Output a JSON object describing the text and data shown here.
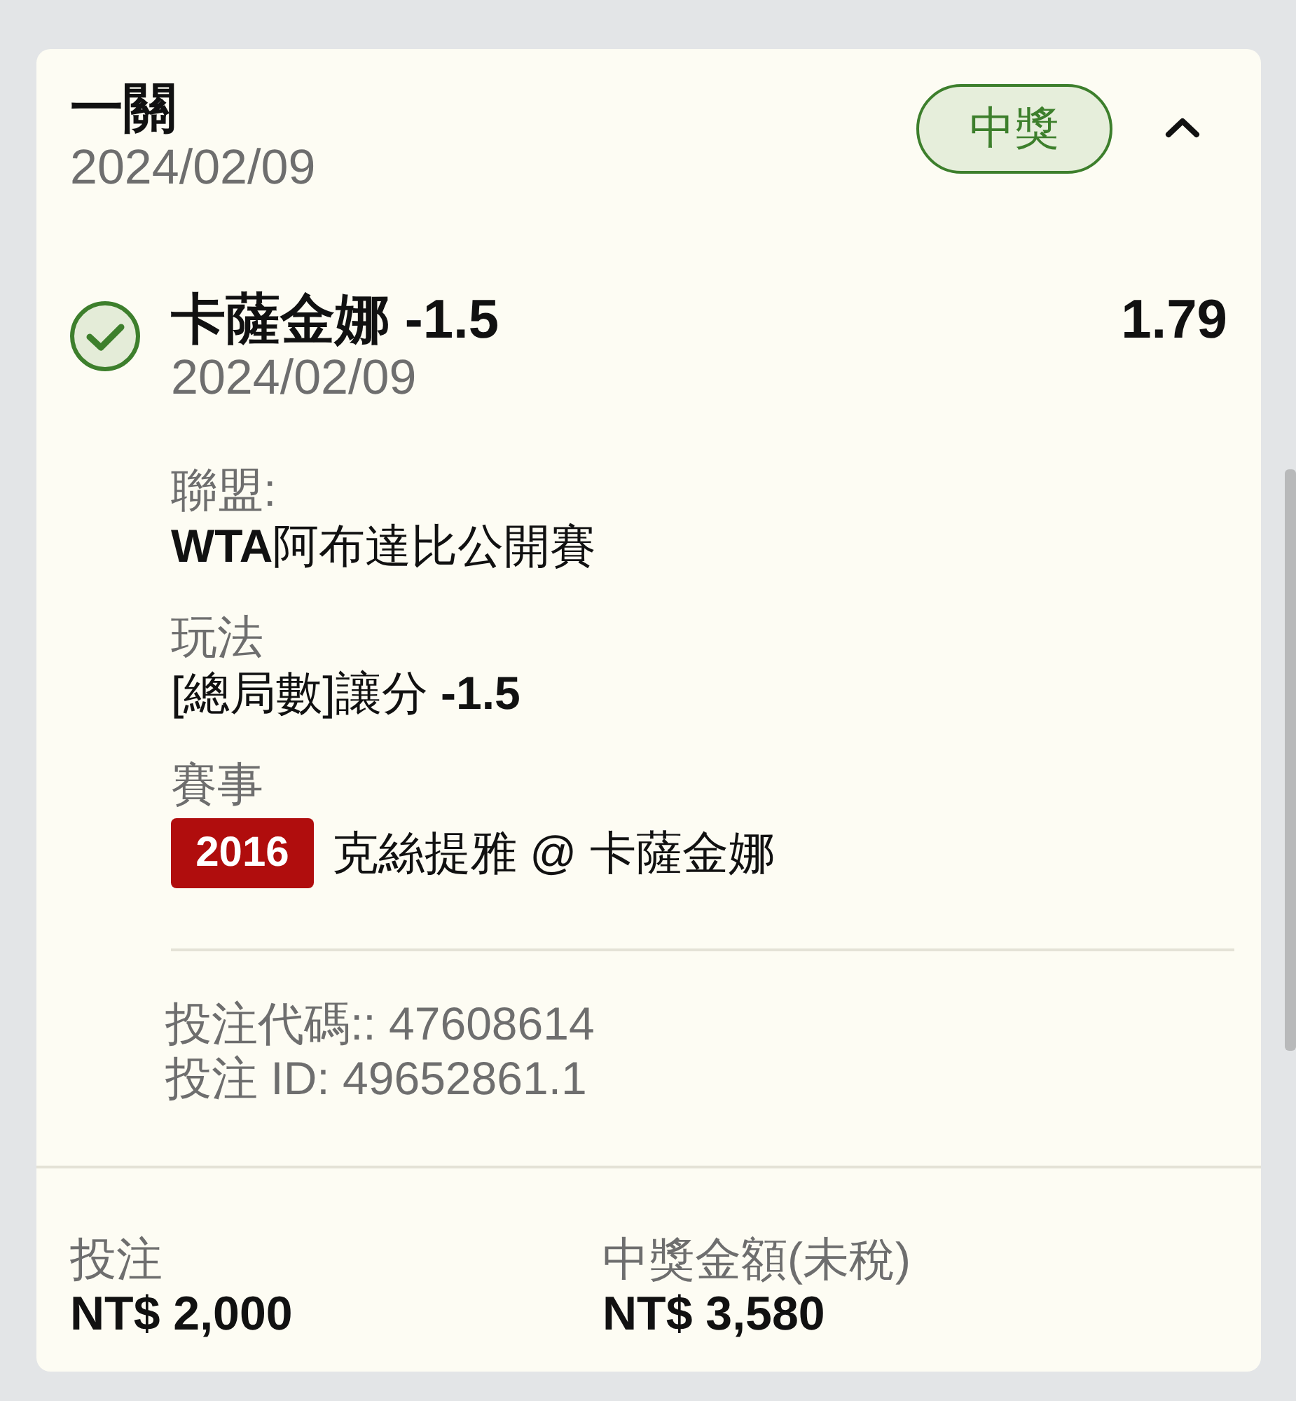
{
  "bet": {
    "title": "一關",
    "date": "2024/02/09",
    "status": {
      "label": "中獎",
      "kind": "won"
    },
    "expanded": true
  },
  "selections": [
    {
      "won": true,
      "title": "卡薩金娜 -1.5",
      "date": "2024/02/09",
      "odds": "1.79",
      "details": [
        {
          "label": "聯盟:",
          "value": "**WTA**阿布達比公開賽"
        },
        {
          "label": "玩法",
          "value": "[總局數]讓分 **-1.5**"
        },
        {
          "label": "賽事",
          "event_code": "2016",
          "value": "克絲提雅 @ 卡薩金娜"
        }
      ]
    }
  ],
  "references": [
    "投注代碼:: 47608614",
    "投注 ID: 49652861.1"
  ],
  "summary": [
    {
      "label": "投注",
      "value": "NT$ 2,000"
    },
    {
      "label": "中獎金額(未稅)",
      "value": "NT$ 3,580"
    }
  ]
}
